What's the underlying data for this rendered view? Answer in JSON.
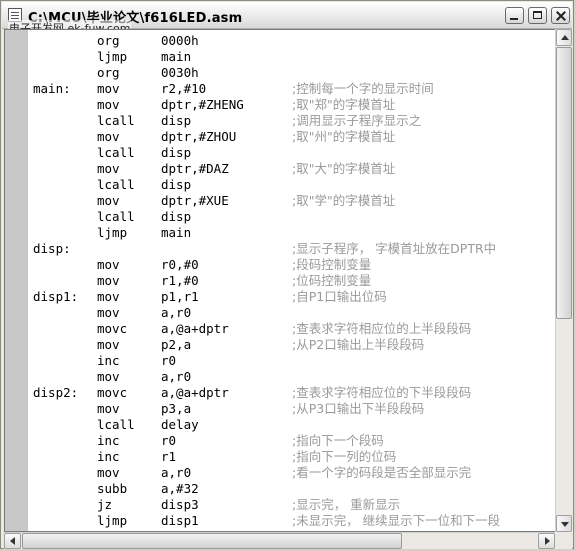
{
  "window": {
    "title": "C:\\MCU\\毕业论文\\f616LED.asm",
    "watermark": "电子开发网  ek-fuw.com"
  },
  "icons": {
    "app": "document-icon",
    "minimize": "minimize-icon",
    "maximize": "maximize-icon",
    "close": "close-icon"
  },
  "code_lines": [
    {
      "label": "",
      "mnemonic": "org",
      "operand": "0000h",
      "comment": ""
    },
    {
      "label": "",
      "mnemonic": "ljmp",
      "operand": "main",
      "comment": ""
    },
    {
      "label": "",
      "mnemonic": "org",
      "operand": "0030h",
      "comment": ""
    },
    {
      "label": "main:",
      "mnemonic": "mov",
      "operand": "r2,#10",
      "comment": ";控制每一个字的显示时间"
    },
    {
      "label": "",
      "mnemonic": "mov",
      "operand": "dptr,#ZHENG",
      "comment": ";取\"郑\"的字模首址"
    },
    {
      "label": "",
      "mnemonic": "lcall",
      "operand": "disp",
      "comment": ";调用显示子程序显示之"
    },
    {
      "label": "",
      "mnemonic": "mov",
      "operand": "dptr,#ZHOU",
      "comment": ";取\"州\"的字模首址"
    },
    {
      "label": "",
      "mnemonic": "lcall",
      "operand": "disp",
      "comment": ""
    },
    {
      "label": "",
      "mnemonic": "mov",
      "operand": "dptr,#DAZ",
      "comment": ";取\"大\"的字模首址"
    },
    {
      "label": "",
      "mnemonic": "lcall",
      "operand": "disp",
      "comment": ""
    },
    {
      "label": "",
      "mnemonic": "mov",
      "operand": "dptr,#XUE",
      "comment": ";取\"学\"的字模首址"
    },
    {
      "label": "",
      "mnemonic": "lcall",
      "operand": "disp",
      "comment": ""
    },
    {
      "label": "",
      "mnemonic": "ljmp",
      "operand": "main",
      "comment": ""
    },
    {
      "label": "disp:",
      "mnemonic": "",
      "operand": "",
      "comment": ";显示子程序， 字模首址放在DPTR中"
    },
    {
      "label": "",
      "mnemonic": "mov",
      "operand": "r0,#0",
      "comment": ";段码控制变量"
    },
    {
      "label": "",
      "mnemonic": "mov",
      "operand": "r1,#0",
      "comment": ";位码控制变量"
    },
    {
      "label": "disp1:",
      "mnemonic": "mov",
      "operand": "p1,r1",
      "comment": ";自P1口输出位码"
    },
    {
      "label": "",
      "mnemonic": "mov",
      "operand": "a,r0",
      "comment": ""
    },
    {
      "label": "",
      "mnemonic": "movc",
      "operand": "a,@a+dptr",
      "comment": ";查表求字符相应位的上半段段码"
    },
    {
      "label": "",
      "mnemonic": "mov",
      "operand": "p2,a",
      "comment": ";从P2口输出上半段段码"
    },
    {
      "label": "",
      "mnemonic": "inc",
      "operand": "r0",
      "comment": ""
    },
    {
      "label": "",
      "mnemonic": "mov",
      "operand": "a,r0",
      "comment": ""
    },
    {
      "label": "disp2:",
      "mnemonic": "movc",
      "operand": "a,@a+dptr",
      "comment": ";查表求字符相应位的下半段段码"
    },
    {
      "label": "",
      "mnemonic": "mov",
      "operand": "p3,a",
      "comment": ";从P3口输出下半段段码"
    },
    {
      "label": "",
      "mnemonic": "lcall",
      "operand": "delay",
      "comment": ""
    },
    {
      "label": "",
      "mnemonic": "inc",
      "operand": "r0",
      "comment": ";指向下一个段码"
    },
    {
      "label": "",
      "mnemonic": "inc",
      "operand": "r1",
      "comment": ";指向下一列的位码"
    },
    {
      "label": "",
      "mnemonic": "mov",
      "operand": "a,r0",
      "comment": ";看一个字的码段是否全部显示完"
    },
    {
      "label": "",
      "mnemonic": "subb",
      "operand": "a,#32",
      "comment": ""
    },
    {
      "label": "",
      "mnemonic": "jz",
      "operand": "disp3",
      "comment": ";显示完， 重新显示"
    },
    {
      "label": "",
      "mnemonic": "ljmp",
      "operand": "disp1",
      "comment": ";未显示完， 继续显示下一位和下一段"
    }
  ]
}
